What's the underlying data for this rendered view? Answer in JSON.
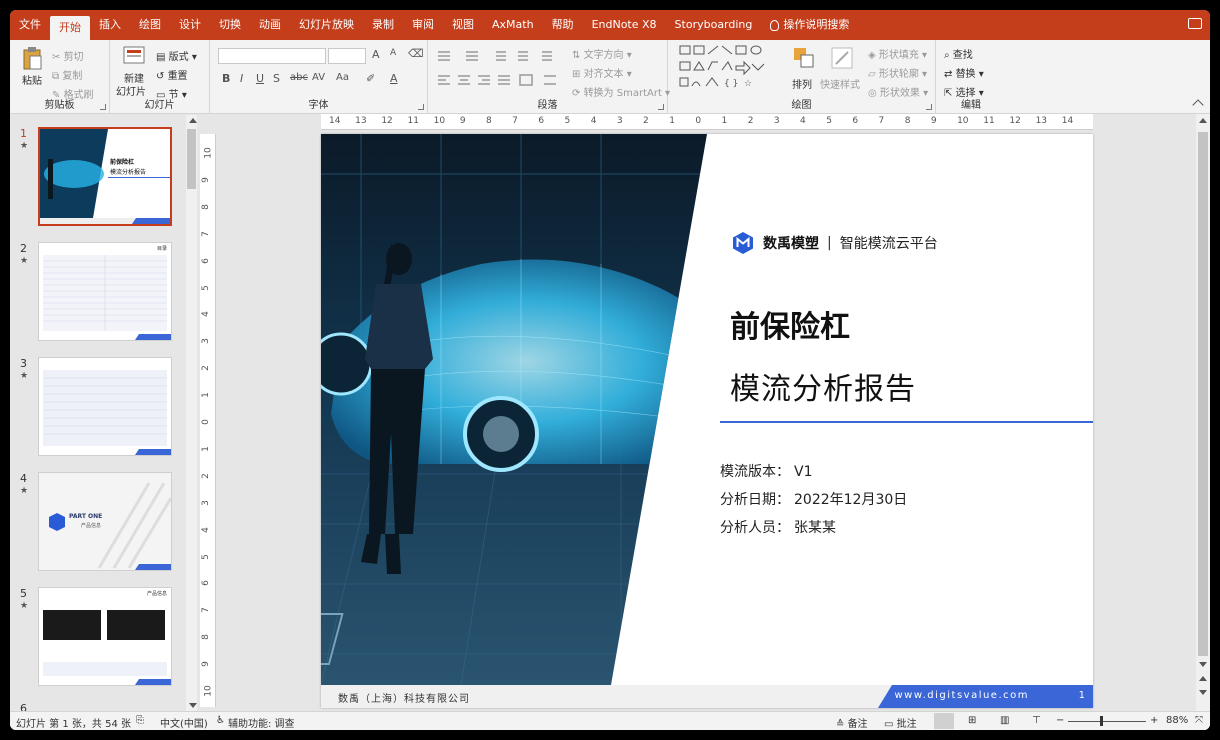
{
  "tabs": [
    "文件",
    "开始",
    "插入",
    "绘图",
    "设计",
    "切换",
    "动画",
    "幻灯片放映",
    "录制",
    "审阅",
    "视图",
    "AxMath",
    "帮助",
    "EndNote X8",
    "Storyboarding"
  ],
  "tab_search": "操作说明搜索",
  "ribbon": {
    "clipboard": {
      "paste": "粘贴",
      "cut": "剪切",
      "copy": "复制",
      "format_painter": "格式刷",
      "label": "剪贴板"
    },
    "slides": {
      "new_slide": "新建",
      "new_slide2": "幻灯片",
      "layout": "版式",
      "reset": "重置",
      "section": "节",
      "label": "幻灯片"
    },
    "font": {
      "label": "字体",
      "bold": "B",
      "italic": "I",
      "underline": "U",
      "strike": "S",
      "shadow": "abc",
      "spacing": "AV",
      "case": "Aa",
      "grow": "A",
      "shrink": "A"
    },
    "paragraph": {
      "text_direction": "文字方向",
      "align_text": "对齐文本",
      "smartart": "转换为 SmartArt",
      "label": "段落"
    },
    "drawing": {
      "arrange": "排列",
      "quick_styles": "快速样式",
      "shape_fill": "形状填充",
      "shape_outline": "形状轮廓",
      "shape_effects": "形状效果",
      "label": "绘图"
    },
    "editing": {
      "find": "查找",
      "replace": "替换",
      "select": "选择",
      "label": "编辑"
    }
  },
  "hruler_ticks": [
    "14",
    "13",
    "12",
    "11",
    "10",
    "9",
    "8",
    "7",
    "6",
    "5",
    "4",
    "3",
    "2",
    "1",
    "0",
    "1",
    "2",
    "3",
    "4",
    "5",
    "6",
    "7",
    "8",
    "9",
    "10",
    "11",
    "12",
    "13",
    "14"
  ],
  "vruler_ticks": [
    "10",
    "9",
    "8",
    "7",
    "6",
    "5",
    "4",
    "3",
    "2",
    "1",
    "0",
    "1",
    "2",
    "3",
    "4",
    "5",
    "6",
    "7",
    "8",
    "9",
    "10"
  ],
  "thumbnails": [
    {
      "num": "1",
      "title": "前保险杠",
      "subtitle": "模流分析报告"
    },
    {
      "num": "2",
      "tag": "目录"
    },
    {
      "num": "3"
    },
    {
      "num": "4",
      "part": "PART ONE",
      "part_sub": "产品信息"
    },
    {
      "num": "5",
      "tag": "产品信息"
    },
    {
      "num": "6"
    }
  ],
  "slide": {
    "brand_name": "数禹模塑",
    "brand_sep": "|",
    "brand_tag": "智能模流云平台",
    "title_line1": "前保险杠",
    "title_line2": "模流分析报告",
    "info": [
      {
        "label": "模流版本：",
        "value": "V1"
      },
      {
        "label": "分析日期：",
        "value": "2022年12月30日"
      },
      {
        "label": "分析人员：",
        "value": "张某某"
      }
    ],
    "company": "数禹（上海）科技有限公司",
    "url": "www.digitsvalue.com",
    "page": "1"
  },
  "status": {
    "slide_pos": "幻灯片 第 1 张，共 54 张",
    "language": "中文(中国)",
    "accessibility": "辅助功能: 调查",
    "notes": "备注",
    "comments": "批注",
    "zoom": "88%"
  },
  "colors": {
    "accent": "#c43e1c",
    "slide_blue": "#3a66d8"
  }
}
